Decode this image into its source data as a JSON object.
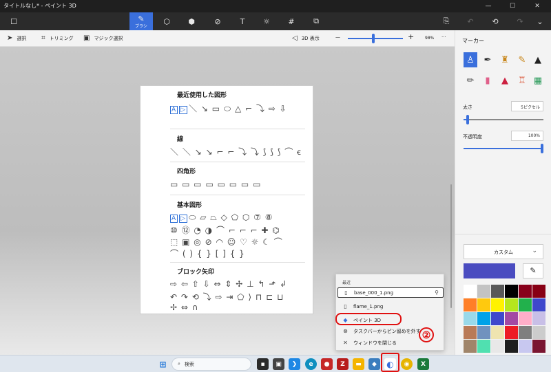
{
  "window": {
    "title": "タイトルなし* - ペイント 3D",
    "minimize": "—",
    "maximize": "☐",
    "close": "✕"
  },
  "toolbar": {
    "brush_label": "ブラシ"
  },
  "subbar": {
    "select": "選択",
    "crop": "トリミング",
    "magic_select": "マジック選択",
    "view3d": "3D 表示",
    "zoom_minus": "—",
    "zoom_plus": "+",
    "zoom": "98%",
    "more": "···",
    "zoom_level": 0.45
  },
  "shapes_panel": {
    "sections": [
      {
        "title": "最近使用した図形",
        "rows": [
          "＼ ↘ ▭ ⬭ △ ⌐ ⤵ ⇨ ⇩"
        ]
      },
      {
        "title": "線",
        "rows": [
          "＼ ＼ ↘ ↘ ⌐ ⌐ ⤵ ⤵ ⟆ ⟆ ⟆ ⌒ ꞓ"
        ]
      },
      {
        "title": "四角形",
        "rows": [
          "▭ ▭ ▭ ▭ ▭ ▭ ▭ ▭"
        ]
      },
      {
        "title": "基本図形",
        "rows": [
          "⬭ ▱ ⏢ ◇ ⬠ ⬡ ⑦ ⑧",
          "⑩ ⑫ ◔ ◑ ⌒ ⌐ ⌐ ⌐ ✚ ⌬",
          "⬚ ▣ ◎ ⊘ ◠ ☺ ♡ ☼ ☾ ⌒",
          "⌒ ( ) { } [ ] { }"
        ]
      },
      {
        "title": "ブロック矢印",
        "rows": [
          "⇨ ⇦ ⇧ ⇩ ⇔ ⇕ ✢ ⊥ ↰ ⬏ ↲",
          "↶ ↷ ⟲ ⤵ ⇨ ⇥ ⬠ ⟩ ⊓ ⊏ ⊔",
          "✢ ⇔ ∩"
        ]
      }
    ],
    "boxed_labels": [
      "A",
      "▷"
    ]
  },
  "right_panel": {
    "title": "マーカー",
    "thickness_label": "太さ",
    "thickness_value": "5ピクセル",
    "thickness_level": 0.05,
    "opacity_label": "不透明度",
    "opacity_value": "100%",
    "opacity_level": 1.0,
    "color_mode": "カスタム",
    "current_color": "#4a4cc0",
    "swatches": [
      "#ffffff",
      "#c3c3c3",
      "#585858",
      "#000000",
      "#88001b",
      "#880015",
      "#ff7f27",
      "#ffc90e",
      "#fff200",
      "#b5e61d",
      "#22b14c",
      "#3f48cc",
      "#99d9ea",
      "#00a2e8",
      "#3f48cc",
      "#a349a4",
      "#ffaec9",
      "#c8bfe7",
      "#b97a57",
      "#7092be",
      "#efe4b0",
      "#ed1c24",
      "#7f7f7f",
      "#cccccc",
      "#a0856a",
      "#50e0b0",
      "#e8e8e8",
      "#1e1e1e",
      "#c8c8f0",
      "#7a1530"
    ]
  },
  "popup_menu": {
    "header": "最近",
    "items": [
      {
        "label": "base_000_1.png",
        "icon": "document-icon"
      },
      {
        "label": "flame_1.png",
        "icon": "document-icon"
      },
      {
        "label": "ペイント 3D",
        "icon": "paint3d-icon"
      },
      {
        "label": "タスクバーからピン留めを外す",
        "icon": "unpin-icon"
      },
      {
        "label": "ウィンドウを閉じる",
        "icon": "close-icon"
      }
    ],
    "annotation": "②"
  },
  "taskbar": {
    "search_placeholder": "検索"
  }
}
